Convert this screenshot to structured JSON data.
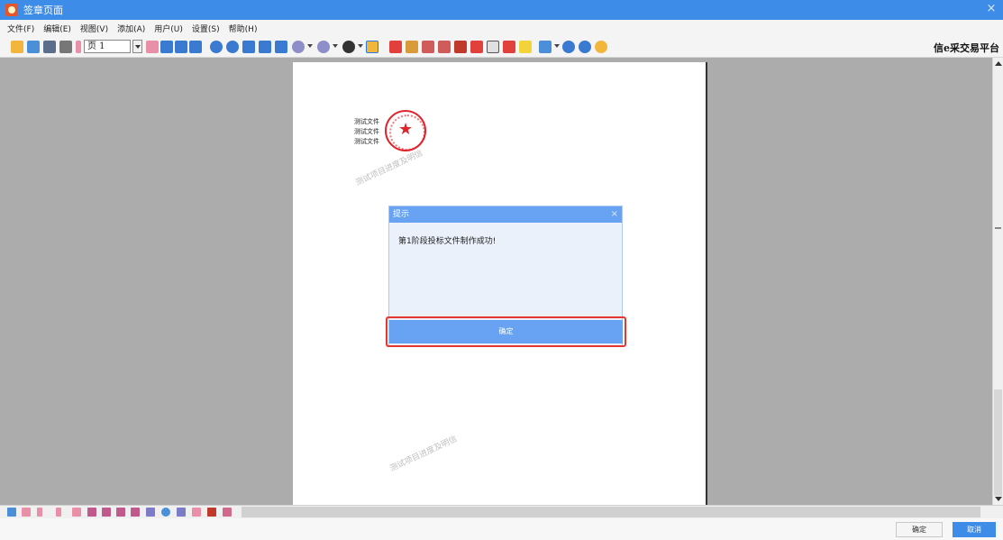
{
  "window": {
    "title": "签章页面"
  },
  "menu": [
    "文件(F)",
    "编辑(E)",
    "视图(V)",
    "添加(A)",
    "用户(U)",
    "设置(S)",
    "帮助(H)"
  ],
  "toolbar": {
    "page_input_value": "页 1",
    "brand": "信e采交易平台"
  },
  "document": {
    "lines": [
      "测试文件",
      "测试文件",
      "测试文件"
    ],
    "watermark": "测试项目进度及明信"
  },
  "dialog": {
    "title": "提示",
    "close": "×",
    "message": "第1阶段投标文件制作成功!",
    "ok_label": "确定"
  },
  "footer": {
    "confirm_label": "确定",
    "cancel_label": "取消"
  },
  "colors": {
    "title_bar": "#3c8ce8",
    "dialog_header": "#67a3f2",
    "highlight": "#e53632",
    "seal": "#e0242c"
  }
}
